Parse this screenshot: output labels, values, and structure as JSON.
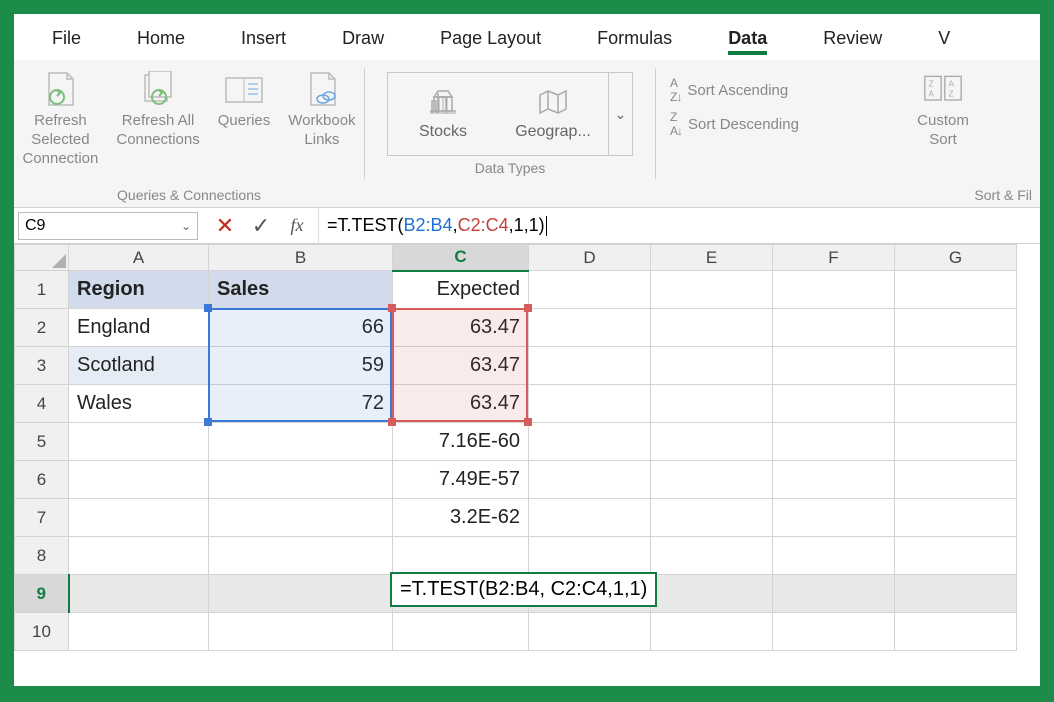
{
  "tabs": {
    "file": "File",
    "home": "Home",
    "insert": "Insert",
    "draw": "Draw",
    "page_layout": "Page Layout",
    "formulas": "Formulas",
    "data": "Data",
    "review": "Review",
    "view": "V"
  },
  "ribbon": {
    "refresh_selected": "Refresh Selected\nConnection",
    "refresh_all": "Refresh All\nConnections",
    "queries": "Queries",
    "workbook_links": "Workbook\nLinks",
    "group_qc": "Queries & Connections",
    "stocks": "Stocks",
    "geography": "Geograp...",
    "group_dt": "Data Types",
    "sort_asc": "Sort Ascending",
    "sort_desc": "Sort Descending",
    "custom_sort": "Custom\nSort",
    "group_sort": "Sort & Fil"
  },
  "namebox": "C9",
  "formula": {
    "prefix": "=T.TEST(",
    "range1": "B2:B4",
    "sep1": ", ",
    "range2": "C2:C4",
    "suffix": ",1,1)"
  },
  "columns": [
    "A",
    "B",
    "C",
    "D",
    "E",
    "F",
    "G"
  ],
  "rows": [
    "1",
    "2",
    "3",
    "4",
    "5",
    "6",
    "7",
    "8",
    "9",
    "10"
  ],
  "cells": {
    "A1": "Region",
    "B1": "Sales",
    "C1": "Expected",
    "A2": "England",
    "B2": "66",
    "C2": "63.47",
    "A3": "Scotland",
    "B3": "59",
    "C3": "63.47",
    "A4": "Wales",
    "B4": "72",
    "C4": "63.47",
    "C5": "7.16E-60",
    "C6": "7.49E-57",
    "C7": "3.2E-62",
    "C9_display": "=T.TEST(B2:B4, C2:C4,1,1)"
  },
  "chart_data": {
    "type": "table",
    "columns": [
      "Region",
      "Sales",
      "Expected"
    ],
    "rows": [
      [
        "England",
        66,
        63.47
      ],
      [
        "Scotland",
        59,
        63.47
      ],
      [
        "Wales",
        72,
        63.47
      ]
    ]
  }
}
